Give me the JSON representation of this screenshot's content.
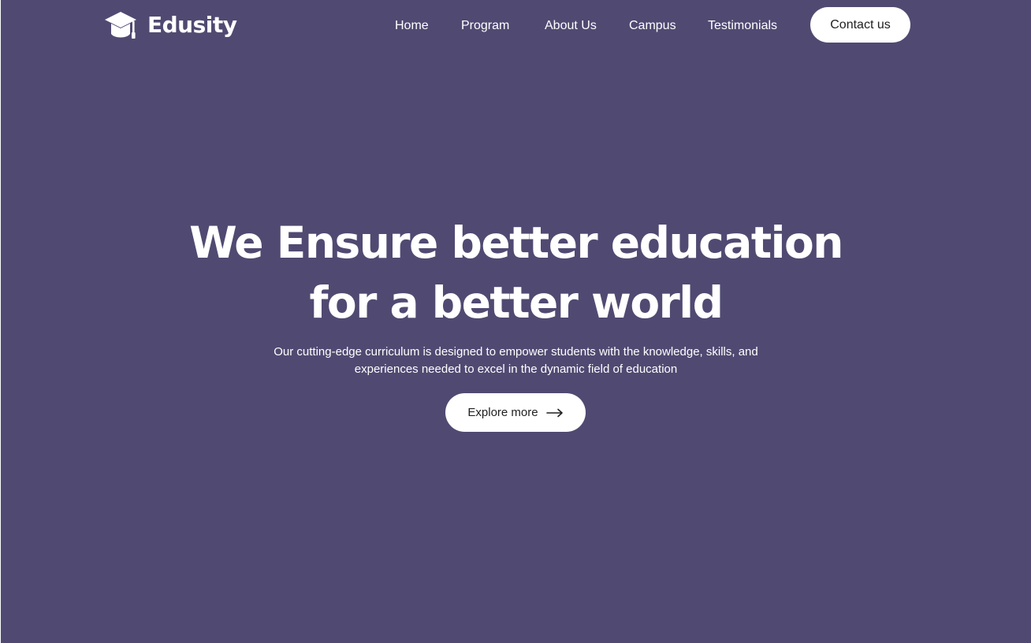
{
  "brand": {
    "name": "Edusity",
    "icon": "graduation-cap-icon"
  },
  "nav": {
    "items": [
      {
        "label": "Home"
      },
      {
        "label": "Program"
      },
      {
        "label": "About Us"
      },
      {
        "label": "Campus"
      },
      {
        "label": "Testimonials"
      }
    ],
    "contact_label": "Contact us"
  },
  "hero": {
    "title_line1": "We Ensure better education",
    "title_line2": "for a better world",
    "desc_line1": "Our cutting-edge curriculum is designed to empower students with the knowledge, skills, and",
    "desc_line2": "experiences needed to excel in the dynamic field of education",
    "button_label": "Explore more",
    "button_icon": "arrow-right-icon"
  },
  "colors": {
    "background": "#504a72",
    "text": "#ffffff",
    "button_bg": "#ffffff",
    "button_text": "#212121"
  }
}
